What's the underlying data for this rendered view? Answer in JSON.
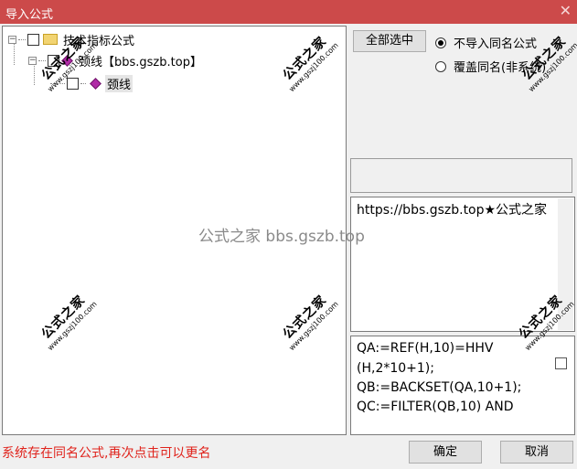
{
  "window": {
    "title": "导入公式",
    "close_glyph": "✕"
  },
  "tree": {
    "root_label": "技术指标公式",
    "group_label": "颈线【bbs.gszb.top】",
    "item_label": "颈线",
    "expander_minus": "−"
  },
  "options": {
    "select_all_label": "全部选中",
    "radio_no_import_label": "不导入同名公式",
    "radio_overwrite_label": "覆盖同名(非系统)"
  },
  "description": {
    "text": "https://bbs.gszb.top★公式之家"
  },
  "code": {
    "lines": [
      "QA:=REF(H,10)=HHV",
      "(H,2*10+1);",
      "QB:=BACKSET(QA,10+1);",
      "QC:=FILTER(QB,10) AND"
    ]
  },
  "status": {
    "text": "系统存在同名公式,再次点击可以更名",
    "color": "#e0231c"
  },
  "buttons": {
    "ok_label": "确定",
    "cancel_label": "取消"
  },
  "watermark": {
    "stamp_text": "公式之家",
    "stamp_url": "www.gszj100.com",
    "center_text": "公式之家 bbs.gszb.top"
  },
  "colors": {
    "titlebar": "#cc4a4a",
    "status": "#e0231c",
    "gem": "#b02aa6"
  }
}
